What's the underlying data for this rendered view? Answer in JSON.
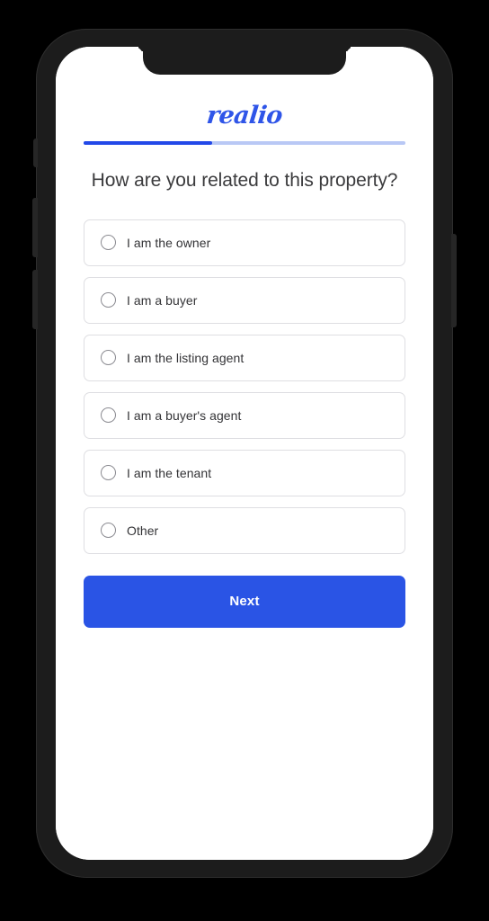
{
  "device": {
    "type": "smartphone",
    "frame_color": "#1c1c1c",
    "background_color": "#000000",
    "buttons": {
      "mute_switch": "mute-switch",
      "volume_up": "volume-up-button",
      "volume_down": "volume-down-button",
      "power": "power-button"
    }
  },
  "app": {
    "brand": {
      "logo_text": "realio",
      "logo_color": "#2f55e8"
    },
    "progress": {
      "percent": 40,
      "fill_color": "#2248e8",
      "track_color": "#b9c8f5"
    },
    "question": "How are you related to this property?",
    "options": [
      {
        "label": "I am the owner",
        "selected": false
      },
      {
        "label": "I am a buyer",
        "selected": false
      },
      {
        "label": "I am the listing agent",
        "selected": false
      },
      {
        "label": "I am a buyer's agent",
        "selected": false
      },
      {
        "label": "I am the tenant",
        "selected": false
      },
      {
        "label": "Other",
        "selected": false
      }
    ],
    "primary_action": {
      "label": "Next",
      "background_color": "#2a54e5",
      "text_color": "#ffffff"
    }
  }
}
